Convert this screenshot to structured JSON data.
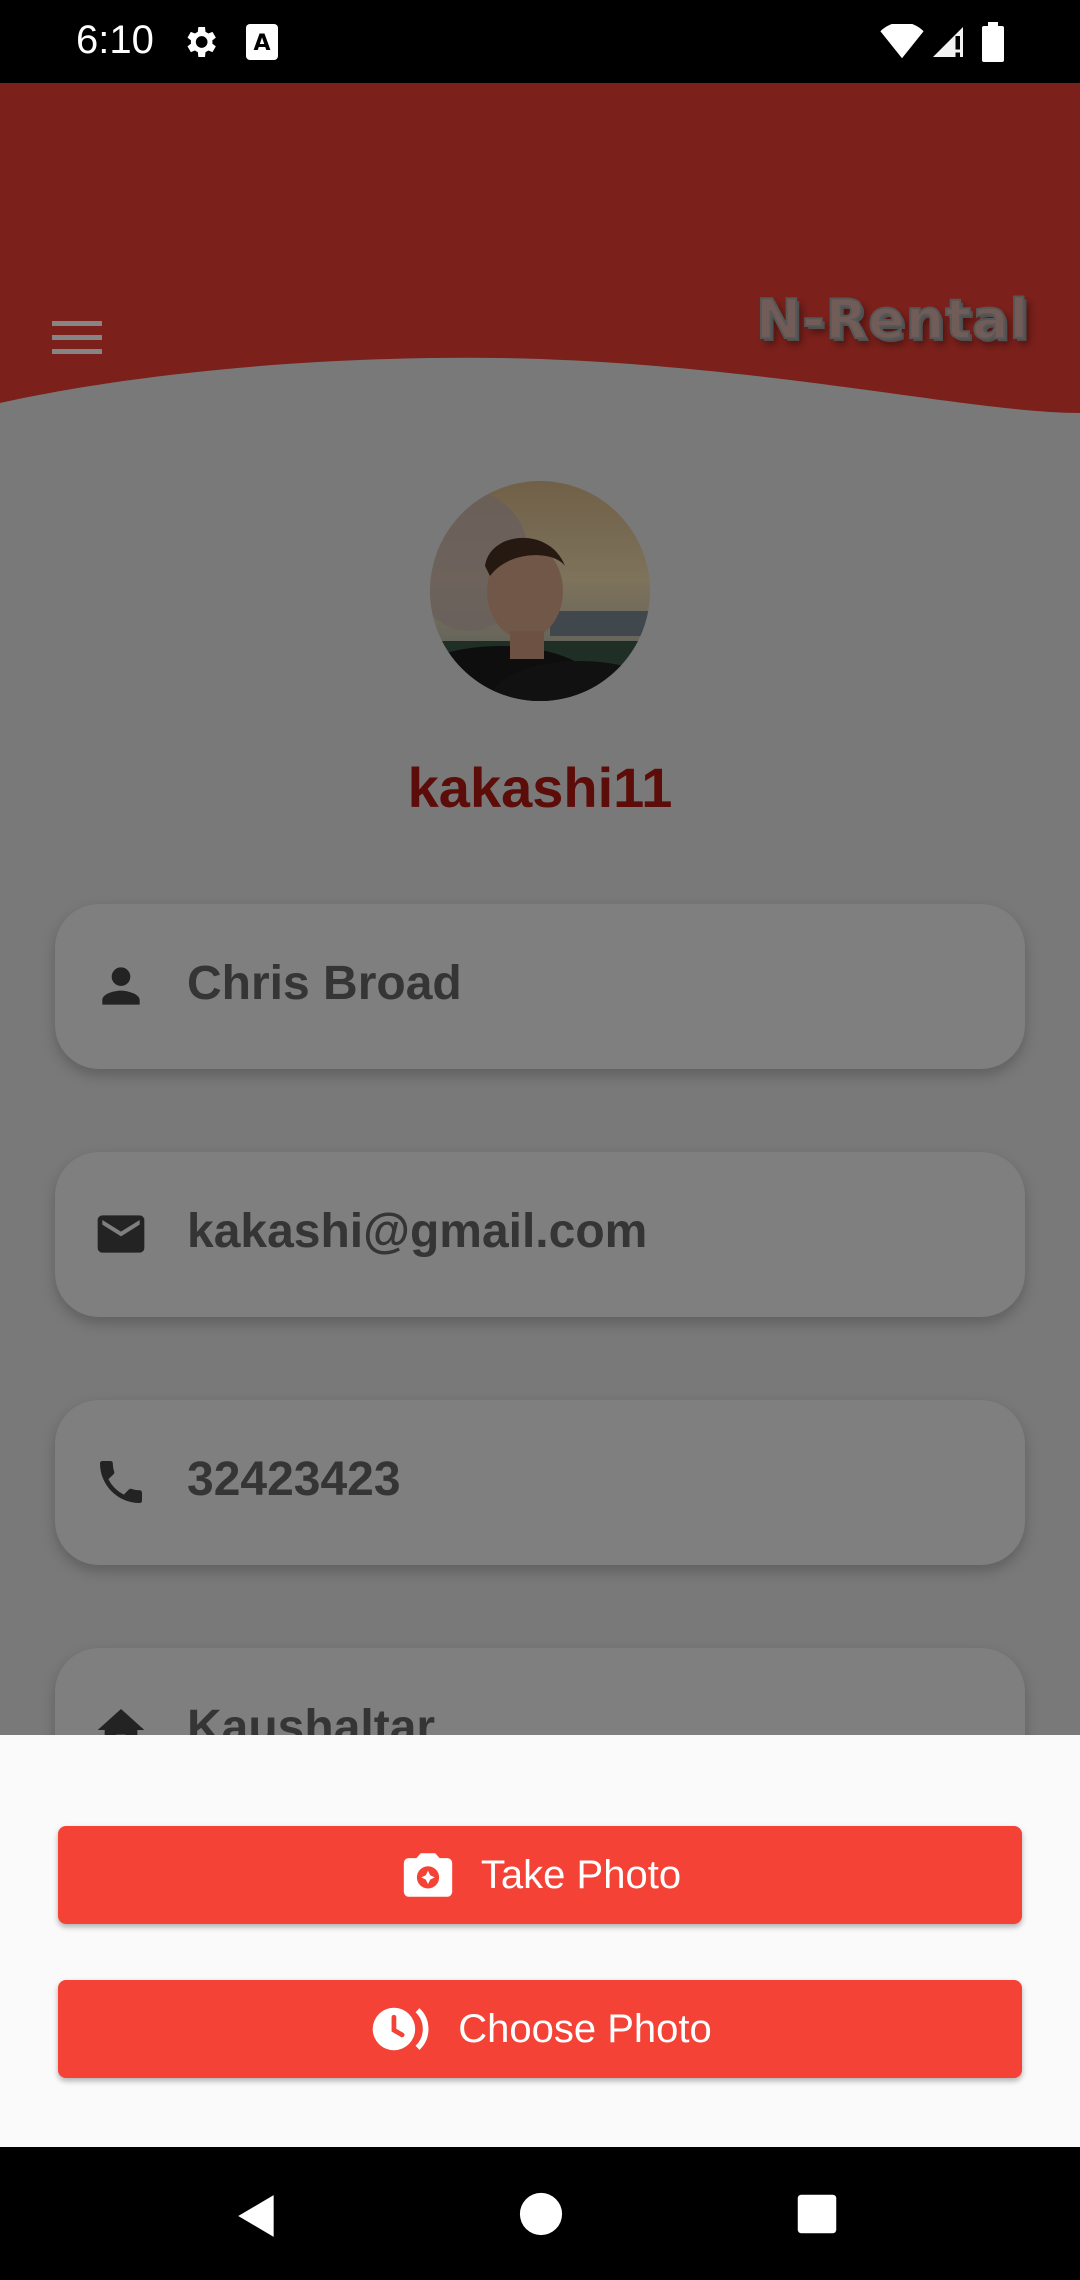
{
  "status_bar": {
    "time": "6:10"
  },
  "header": {
    "brand": "N-Rental",
    "header_color": "#ec3f34",
    "menu_icon": "hamburger-menu-icon"
  },
  "profile": {
    "username": "kakashi11",
    "username_color": "#b11a12",
    "fields": [
      {
        "icon": "person-icon",
        "value": "Chris Broad"
      },
      {
        "icon": "email-icon",
        "value": "kakashi@gmail.com"
      },
      {
        "icon": "phone-icon",
        "value": "32423423"
      },
      {
        "icon": "home-icon",
        "value": "Kaushaltar"
      }
    ]
  },
  "bottom_sheet": {
    "take_photo_label": "Take Photo",
    "choose_photo_label": "Choose Photo",
    "button_color": "#f44336"
  }
}
